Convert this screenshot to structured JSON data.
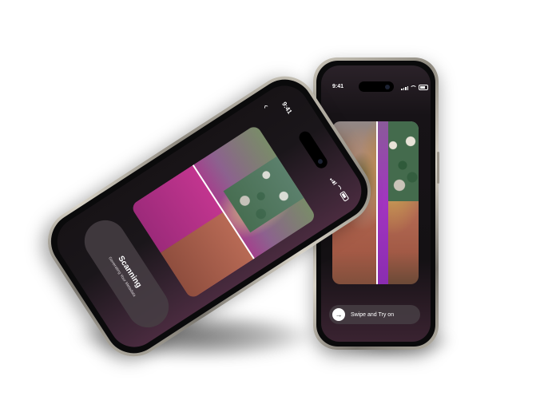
{
  "left_phone": {
    "status_time": "9:41",
    "back_glyph": "‹",
    "scan_title": "Scanning",
    "scan_subtitle": "Generating Your Metadata",
    "icons": [
      "chevron-left-icon",
      "signal-icon",
      "wifi-icon",
      "battery-icon"
    ]
  },
  "right_phone": {
    "status_time": "9:41",
    "swipe_label": "Swipe and Try on",
    "swipe_glyph": "→",
    "icons": [
      "signal-icon",
      "wifi-icon",
      "battery-icon",
      "arrow-right-icon"
    ]
  },
  "colors": {
    "frame": "#b3aea3",
    "screen": "#161316",
    "tryon_accent": "#b52f8e",
    "pill": "#463e44"
  }
}
